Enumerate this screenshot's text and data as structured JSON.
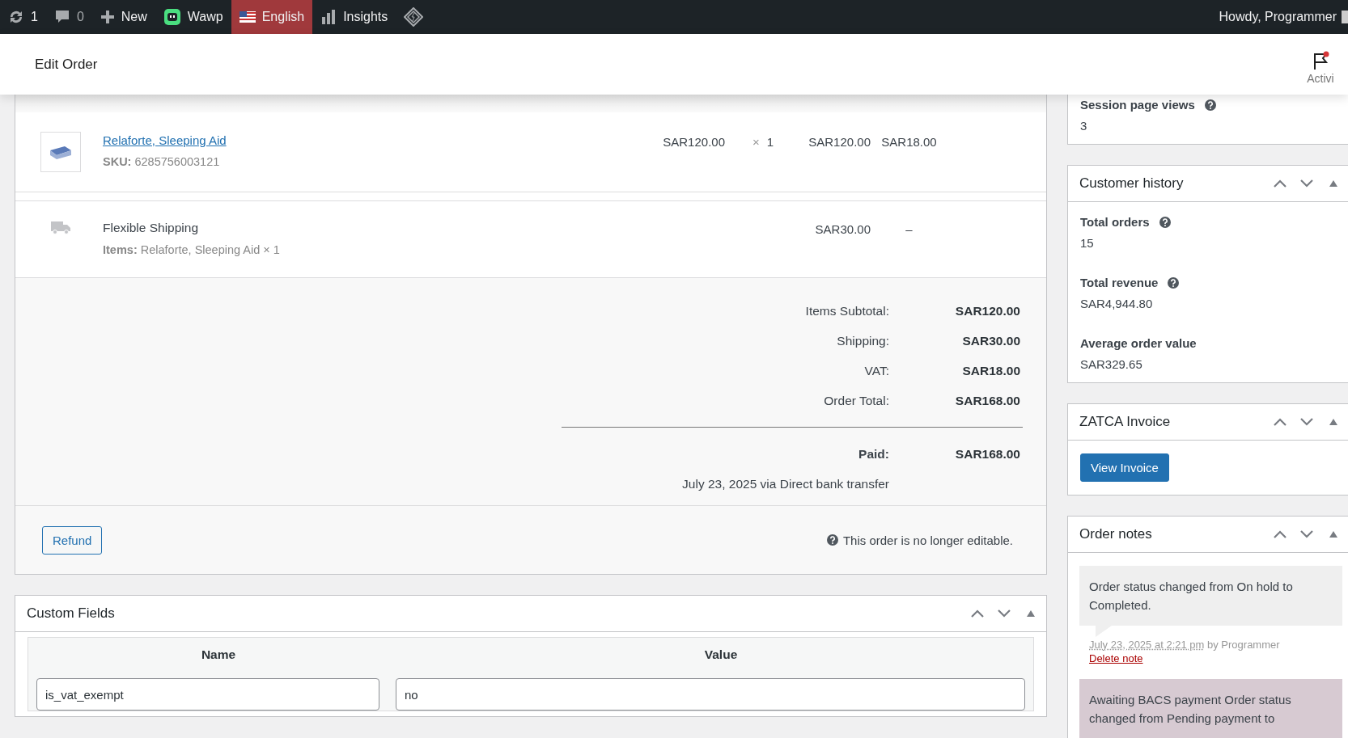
{
  "admin_bar": {
    "items": [
      {
        "kind": "updates",
        "label": "1",
        "active": false
      },
      {
        "kind": "comments",
        "label": "0",
        "active": false
      },
      {
        "kind": "new",
        "label": "New",
        "active": false
      },
      {
        "kind": "wawp",
        "label": "Wawp",
        "active": false
      },
      {
        "kind": "language",
        "label": "English",
        "active": true
      },
      {
        "kind": "insights",
        "label": "Insights",
        "active": false
      },
      {
        "kind": "diamond",
        "active": false
      }
    ],
    "greeting": "Howdy, Programmer"
  },
  "header": {
    "title": "Edit Order",
    "activity_label": "Activi"
  },
  "line_items": [
    {
      "kind": "product",
      "name": "Relaforte, Sleeping Aid",
      "sku_label": "SKU:",
      "sku": "6285756003121",
      "cost": "SAR120.00",
      "qty_sign": "×",
      "qty": "1",
      "total": "SAR120.00",
      "tax": "SAR18.00"
    },
    {
      "kind": "shipping",
      "name": "Flexible Shipping",
      "items_label": "Items:",
      "items": "Relaforte, Sleeping Aid × 1",
      "total": "SAR30.00",
      "tax": "–"
    }
  ],
  "totals": [
    {
      "label": "Items Subtotal:",
      "value": "SAR120.00"
    },
    {
      "label": "Shipping:",
      "value": "SAR30.00"
    },
    {
      "label": "VAT:",
      "value": "SAR18.00"
    },
    {
      "label": "Order Total:",
      "value": "SAR168.00"
    }
  ],
  "paid": {
    "label": "Paid:",
    "value": "SAR168.00",
    "note": "July 23, 2025 via Direct bank transfer"
  },
  "refund_button": "Refund",
  "not_editable": "This order is no longer editable.",
  "custom_fields": {
    "title": "Custom Fields",
    "columns": [
      "Name",
      "Value"
    ],
    "rows": [
      {
        "name": "is_vat_exempt",
        "value": "no"
      }
    ]
  },
  "sidebar": {
    "session": {
      "label": "Session page views",
      "value": "3"
    },
    "customer_history": {
      "title": "Customer history",
      "stats": [
        {
          "label": "Total orders",
          "value": "15",
          "help": true
        },
        {
          "label": "Total revenue",
          "value": "SAR4,944.80",
          "help": true
        },
        {
          "label": "Average order value",
          "value": "SAR329.65",
          "help": false
        }
      ]
    },
    "zatca": {
      "title": "ZATCA Invoice",
      "button": "View Invoice"
    },
    "order_notes": {
      "title": "Order notes",
      "notes": [
        {
          "kind": "private",
          "text": "Order status changed from On hold to Completed.",
          "date": "July 23, 2025 at 2:21 pm",
          "by": "by Programmer",
          "delete": "Delete note"
        },
        {
          "kind": "system",
          "text": "Awaiting BACS payment Order status changed from Pending payment to"
        }
      ]
    }
  }
}
